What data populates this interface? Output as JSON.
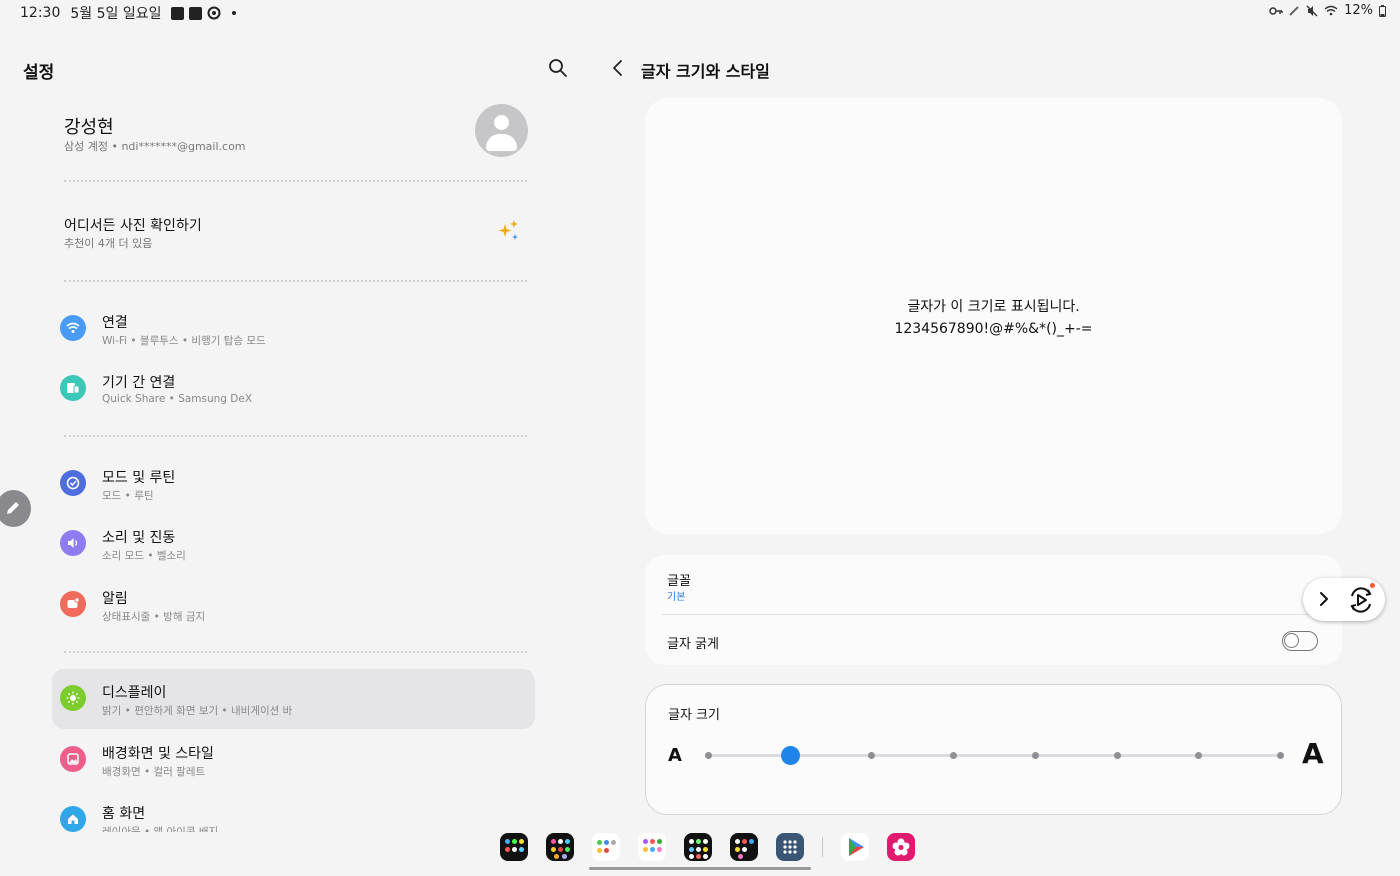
{
  "status": {
    "time": "12:30",
    "date": "5월 5일 일요일",
    "battery": "12%",
    "icons_left": [
      "gallery-icon",
      "calendar-icon",
      "circle-play-icon",
      "dot-icon"
    ],
    "icons_right": [
      "key-icon",
      "pen-icon",
      "mute-icon",
      "wifi-icon",
      "battery-icon"
    ]
  },
  "left": {
    "title": "설정",
    "profile": {
      "name": "강성현",
      "account": "삼성 계정 • ndi*******@gmail.com"
    },
    "suggestion": {
      "title": "어디서든 사진 확인하기",
      "subtitle": "추천이 4개 더 있음"
    },
    "items": [
      {
        "title": "연결",
        "sub": "Wi-Fi • 블루투스 • 비행기 탑승 모드",
        "color": "#4a9bf5"
      },
      {
        "title": "기기 간 연결",
        "sub": "Quick Share • Samsung DeX",
        "color": "#3cc8b8"
      },
      {
        "title": "모드 및 루틴",
        "sub": "모드 • 루틴",
        "color": "#4e6ee0"
      },
      {
        "title": "소리 및 진동",
        "sub": "소리 모드 • 벨소리",
        "color": "#8f7cf0"
      },
      {
        "title": "알림",
        "sub": "상태표시줄 • 방해 금지",
        "color": "#f06b5c"
      },
      {
        "title": "디스플레이",
        "sub": "밝기 • 편안하게 화면 보기 • 내비게이션 바",
        "color": "#7ccc2d"
      },
      {
        "title": "배경화면 및 스타일",
        "sub": "배경화면 • 컬러 팔레트",
        "color": "#ec5f8a"
      },
      {
        "title": "홈 화면",
        "sub": "레이아웃 • 앱 아이콘 배지",
        "color": "#2fa7e8"
      }
    ]
  },
  "right": {
    "title": "글자 크기와 스타일",
    "preview_line1": "글자가 이 크기로 표시됩니다.",
    "preview_line2": "1234567890!@#%&*()_+-=",
    "font_label": "글꼴",
    "font_value": "기본",
    "bold_label": "글자 굵게",
    "bold_on": false,
    "size_label": "글자 크기",
    "a_small": "A",
    "a_large": "A",
    "size_steps": 8,
    "size_selected_index": 1
  },
  "dock": {
    "apps": [
      "app-folder-1",
      "app-folder-2",
      "app-folder-3",
      "app-folder-4",
      "app-folder-5",
      "app-folder-6",
      "apps-drawer-icon",
      "play-store-icon",
      "blossom-app-icon"
    ]
  }
}
